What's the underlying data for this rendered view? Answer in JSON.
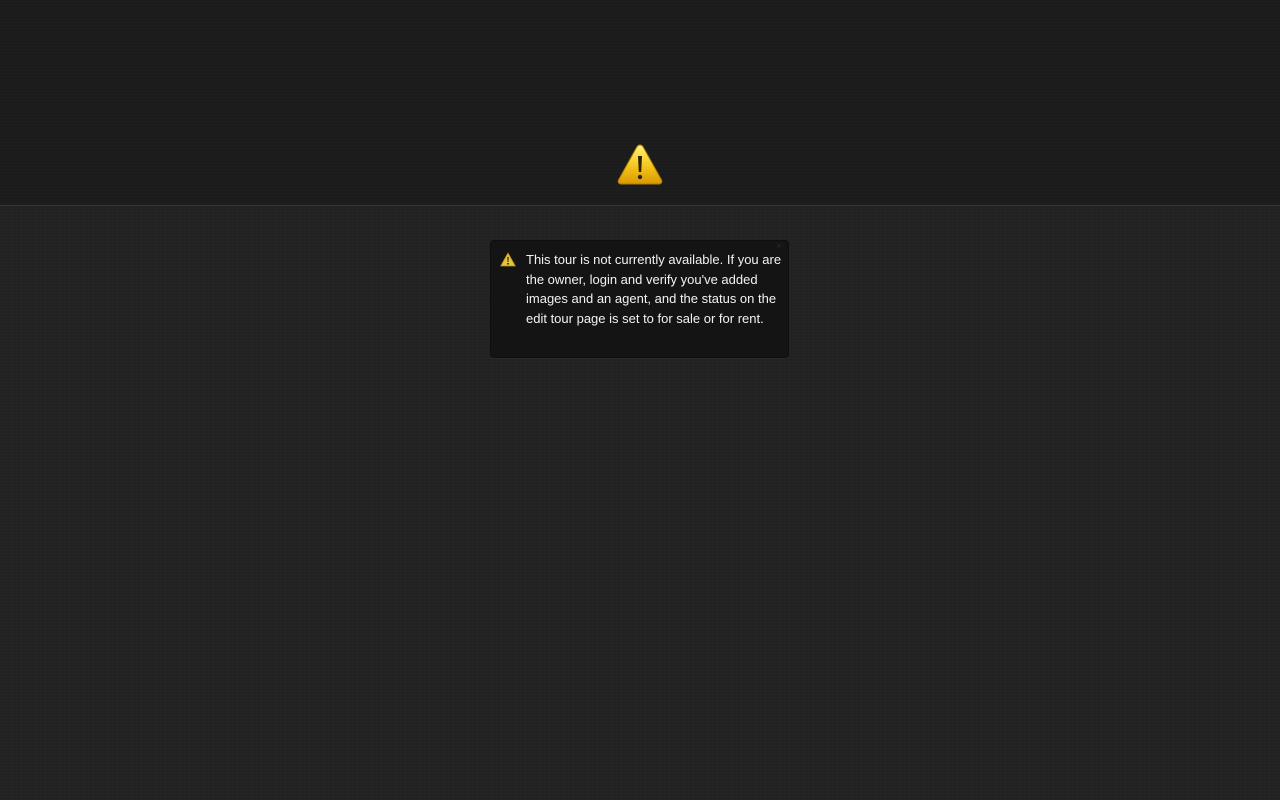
{
  "header": {
    "icon": "warning-icon"
  },
  "notice": {
    "icon": "warning-icon",
    "message": "This tour is not currently available. If you are the owner, login and verify you've added images and an agent, and the status on the edit tour page is set to for sale or for rent.",
    "close_label": "×",
    "colors": {
      "warning_fill": "#f2c21b",
      "warning_dark": "#c78f00",
      "background": "#141414",
      "text": "#f2f2f2"
    }
  }
}
